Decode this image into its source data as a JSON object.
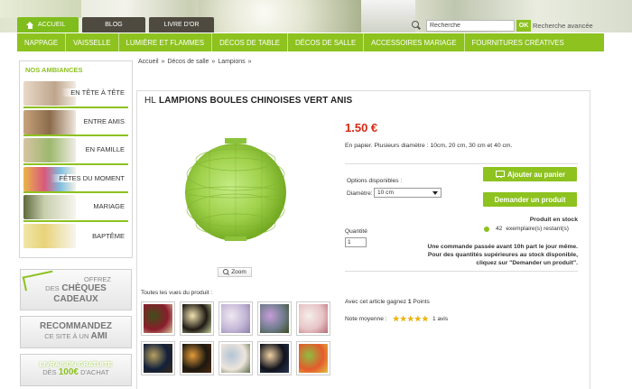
{
  "header": {
    "tabs": [
      {
        "label": "Accueil"
      },
      {
        "label": "Blog"
      },
      {
        "label": "Livre d'or"
      }
    ],
    "search": {
      "value": "Recherche",
      "ok_label": "OK",
      "advanced_label": "Recherche avancée"
    }
  },
  "nav": {
    "items": [
      "Nappage",
      "Vaisselle",
      "Lumière et flammes",
      "Décos de table",
      "Décos de salle",
      "Accessoires mariage",
      "Fournitures créatives"
    ]
  },
  "sidebar": {
    "title": "Nos ambiances",
    "items": [
      {
        "label": "En tête à tête"
      },
      {
        "label": "Entre amis"
      },
      {
        "label": "En famille"
      },
      {
        "label": "Fêtes du moment"
      },
      {
        "label": "Mariage"
      },
      {
        "label": "Baptême"
      }
    ],
    "promos": {
      "cheques": {
        "line1": "Offrez",
        "line2": "des",
        "big": "Chèques",
        "big2": "Cadeaux"
      },
      "recommend": {
        "big": "Recommandez",
        "line": "ce site à un",
        "big2": "Ami"
      },
      "shipping": {
        "line1": "Livraison gratuite",
        "line2": "dès",
        "big": "100€",
        "line3": "d'achat"
      }
    }
  },
  "breadcrumb": {
    "items": [
      "Accueil",
      "Décos de salle",
      "Lampions"
    ],
    "sep": "»"
  },
  "product": {
    "title_prefix": "HL",
    "title": "Lampions boules chinoises vert anis",
    "price": "1.50 €",
    "description": "En papier. Plusieurs diamètre : 10cm, 20 cm, 30 cm et 40 cm.",
    "options_label": "Options disponibles :",
    "diameter_label": "Diamètre:",
    "diameter_value": "10 cm",
    "quantity_label": "Quantité",
    "quantity_value": "1",
    "add_to_cart_label": "Ajouter au panier",
    "ask_label": "Demander un produit",
    "stock_status": "Produit en stock",
    "stock_count": "42",
    "stock_unit": "exemplaire(s) restant(s)",
    "ship_note_1": "Une commande passée avant 10h part le jour même.",
    "ship_note_2": "Pour des quantités supérieures au stock disponible,",
    "ship_note_3": "cliquez sur \"Demander un produit\".",
    "zoom_label": "Zoom",
    "views_label": "Toutes les vues du produit :",
    "points_text": "Avec cet article gagnez",
    "points_value": "1",
    "points_unit": "Points",
    "rating_label": "Note moyenne :",
    "rating_stars": 5,
    "review_count": "1 avis",
    "thumbnails": [
      {
        "colors": [
          "#8a1d2c",
          "#3e4f1a",
          "#d9c7a2"
        ]
      },
      {
        "colors": [
          "#201a14",
          "#f0e3b0",
          "#c6cf9d"
        ]
      },
      {
        "colors": [
          "#c4b7d8",
          "#efe8f1",
          "#8b7fa8"
        ]
      },
      {
        "colors": [
          "#6f7c8c",
          "#c69dd8",
          "#3c4a1f"
        ]
      },
      {
        "colors": [
          "#e7c3c5",
          "#f5eee9",
          "#b46a75"
        ]
      },
      {
        "colors": [
          "#12203a",
          "#b8a060",
          "#3b2b18"
        ]
      },
      {
        "colors": [
          "#1d1810",
          "#e39b3a",
          "#4e2a12"
        ]
      },
      {
        "colors": [
          "#ede5dc",
          "#b2c4d6",
          "#5e6e4b"
        ]
      },
      {
        "colors": [
          "#11141c",
          "#f1d0a3",
          "#2b3555"
        ]
      },
      {
        "colors": [
          "#e45b2c",
          "#8fbd3f",
          "#e0c040"
        ]
      }
    ]
  },
  "colors": {
    "accent": "#8dc21f",
    "price": "#d62a14",
    "dark_tab": "#4e4a40"
  }
}
